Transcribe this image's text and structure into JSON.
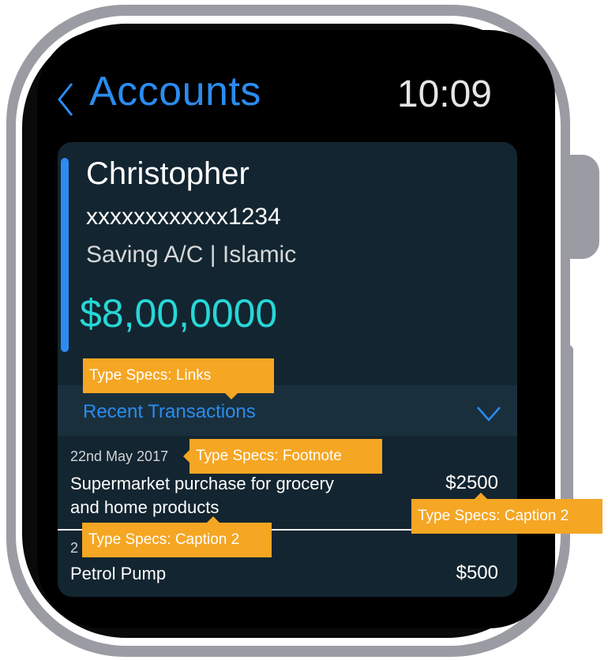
{
  "header": {
    "back_icon": "chevron-left-icon",
    "title": "Accounts",
    "time": "10:09"
  },
  "account": {
    "name": "Christopher",
    "number": "xxxxxxxxxxxx1234",
    "type": "Saving A/C | Islamic",
    "balance": "$8,00,0000"
  },
  "recent": {
    "label": "Recent Transactions",
    "chevron_icon": "chevron-down-icon"
  },
  "transactions": [
    {
      "date": "22nd May 2017",
      "description": "Supermarket purchase for grocery and home products",
      "amount": "$2500"
    },
    {
      "date": "2",
      "description": "Petrol Pump",
      "amount": "$500"
    }
  ],
  "annotations": {
    "links": "Type Specs: Links",
    "footnote": "Type Specs: Footnote",
    "caption2_left": "Type Specs: Caption 2",
    "caption2_right": "Type Specs: Caption 2"
  },
  "colors": {
    "accent_blue": "#2a8cf0",
    "balance_teal": "#27d7d7",
    "card_bg": "#132530",
    "callout_orange": "#f5a623",
    "watch_gray": "#9b9ca3"
  }
}
